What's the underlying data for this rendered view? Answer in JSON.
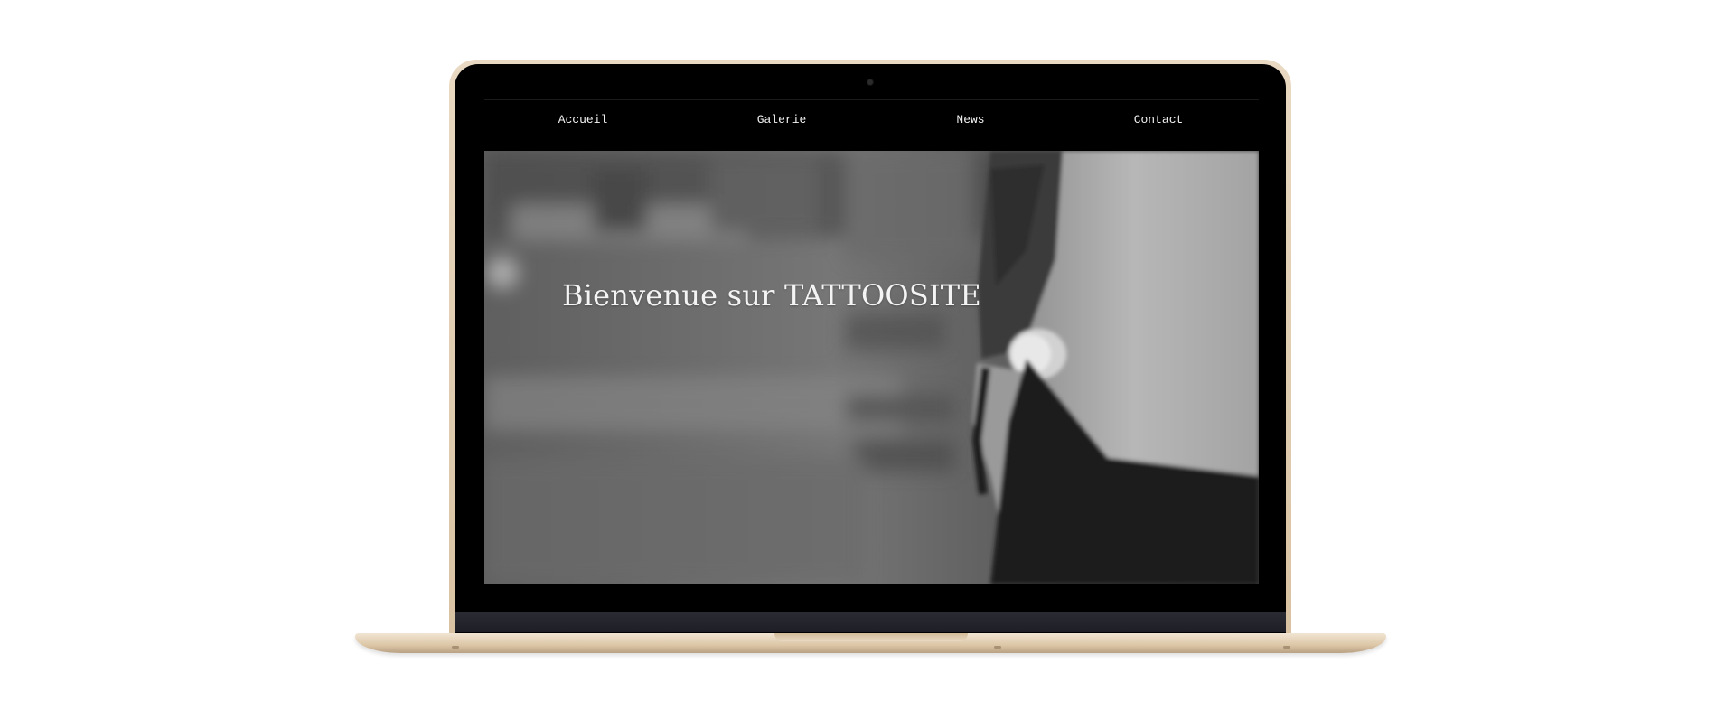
{
  "nav": {
    "items": [
      "Accueil",
      "Galerie",
      "News",
      "Contact"
    ]
  },
  "hero": {
    "title": "Bienvenue sur TATTOOSITE"
  },
  "colors": {
    "frame": "#e2cfb2",
    "bezel": "#000000",
    "nav_background": "#000000",
    "nav_text": "#f2f2f2",
    "hero_text": "#f4f4f4"
  },
  "icons": {
    "camera": "camera-icon"
  }
}
